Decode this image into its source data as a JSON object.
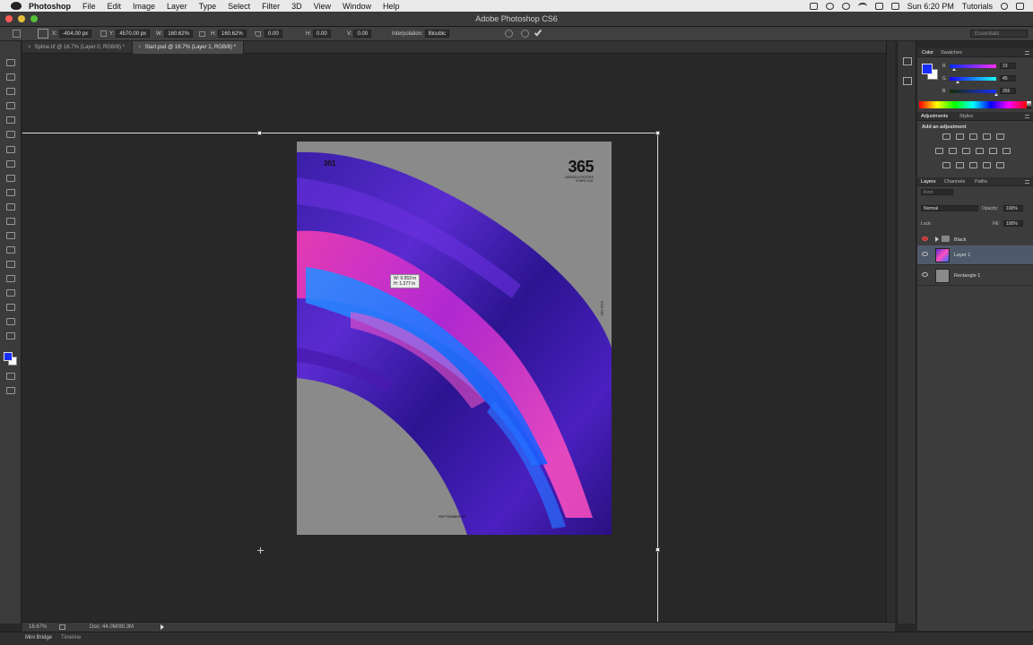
{
  "menubar": {
    "app": "Photoshop",
    "items": [
      "File",
      "Edit",
      "Image",
      "Layer",
      "Type",
      "Select",
      "Filter",
      "3D",
      "View",
      "Window",
      "Help"
    ],
    "clock": "Sun 6:20 PM",
    "user": "Tutorials"
  },
  "window": {
    "title": "Adobe Photoshop CS6",
    "traffic_colors": [
      "#fc5b57",
      "#e5bf3c",
      "#57c038"
    ]
  },
  "options": {
    "x_label": "X:",
    "x_value": "-404.00 px",
    "y_label": "Y:",
    "y_value": "4570.00 px",
    "w_label": "W:",
    "w_value": "160.62%",
    "h_label": "H:",
    "h_value": "160.62%",
    "angle_value": "0.00",
    "hskew_label": "H:",
    "hskew_value": "0.00",
    "vskew_label": "V:",
    "vskew_value": "0.00",
    "interp_label": "Interpolation:",
    "interp_value": "Bicubic",
    "workspace": "Essentials"
  },
  "doc_tabs": [
    {
      "label": "Spline.tif @ 16.7% (Layer 0, RGB/8) *",
      "active": false
    },
    {
      "label": "Start.psd @ 16.7% (Layer 1, RGB/8) *",
      "active": true
    }
  ],
  "poster": {
    "big_number": "365",
    "subtitle_1": "DESIGN A POSTER",
    "subtitle_2": "EVERY DAY",
    "code": "301",
    "side_text": "001 NOS",
    "date": "SEPTEMBER 29"
  },
  "measure_tip": {
    "line1": "W: 9.553 in",
    "line2": "H: 1.277 in"
  },
  "status": {
    "zoom": "16.67%",
    "doc_size": "Doc: 44.0M/90.3M"
  },
  "bottom_tabs": [
    "Mini Bridge",
    "Timeline"
  ],
  "color_panel": {
    "tabs": [
      "Color",
      "Swatches"
    ],
    "r_label": "R",
    "r_value": "23",
    "g_label": "G",
    "g_value": "45",
    "b_label": "B",
    "b_value": "255",
    "r_level": 0.09,
    "g_level": 0.18,
    "b_level": 1.0,
    "foreground": "#172dff",
    "background": "#ffffff"
  },
  "adjustments_panel": {
    "tabs": [
      "Adjustments",
      "Styles"
    ],
    "heading": "Add an adjustment"
  },
  "layers_panel": {
    "tabs": [
      "Layers",
      "Channels",
      "Paths"
    ],
    "kind_filter": "Kind",
    "blend_mode": "Normal",
    "opacity_label": "Opacity:",
    "opacity_value": "100%",
    "lock_label": "Lock:",
    "fill_label": "Fill:",
    "fill_value": "100%",
    "layers": [
      {
        "name": "Black",
        "type": "group",
        "selected": false
      },
      {
        "name": "Layer 1",
        "type": "pixel",
        "selected": true
      },
      {
        "name": "Rectangle 1",
        "type": "shape",
        "selected": false
      }
    ]
  }
}
